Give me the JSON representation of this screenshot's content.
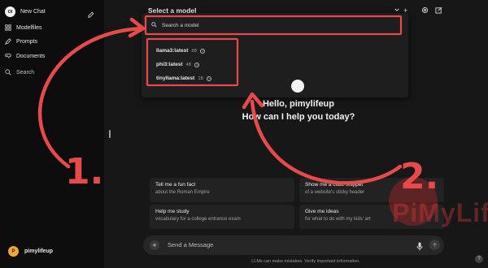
{
  "sidebar": {
    "new_chat_label": "New Chat",
    "logo_text": "OI",
    "items": [
      {
        "label": "Modelfiles",
        "icon": "modelfiles-icon"
      },
      {
        "label": "Prompts",
        "icon": "pen-icon"
      },
      {
        "label": "Documents",
        "icon": "documents-icon"
      },
      {
        "label": "Search",
        "icon": "search-icon"
      }
    ],
    "user": {
      "initial": "P",
      "name": "pimylifeup",
      "avatar_color": "#f2a63a"
    }
  },
  "topbar": {
    "title": "Select a model"
  },
  "model_selector": {
    "search_placeholder": "Search a model",
    "models": [
      {
        "name": "llama3:latest",
        "size": "8B"
      },
      {
        "name": "phi3:latest",
        "size": "4B"
      },
      {
        "name": "tinyllama:latest",
        "size": "1B"
      }
    ]
  },
  "greeting": {
    "line1": "Hello, pimylifeup",
    "line2": "How can I help you today?"
  },
  "suggestions": [
    {
      "title": "Tell me a fun fact",
      "subtitle": "about the Roman Empire"
    },
    {
      "title": "Show me a code snippet",
      "subtitle": "of a website's sticky header"
    },
    {
      "title": "Help me study",
      "subtitle": "vocabulary for a college entrance exam"
    },
    {
      "title": "Give me ideas",
      "subtitle": "for what to do with my kids' art"
    }
  ],
  "composer": {
    "placeholder": "Send a Message",
    "disclaimer": "LLMs can make mistakes. Verify important information.",
    "help_label": "?"
  },
  "annotations": {
    "step1": "1.",
    "step2": "2.",
    "color": "#e64a4a"
  },
  "watermark": {
    "text": "PiMyLifeUp"
  },
  "colors": {
    "sidebar_bg": "#0d0d0d",
    "main_bg": "#171717",
    "card_bg": "#222222",
    "accent_red": "#e64a4a"
  }
}
